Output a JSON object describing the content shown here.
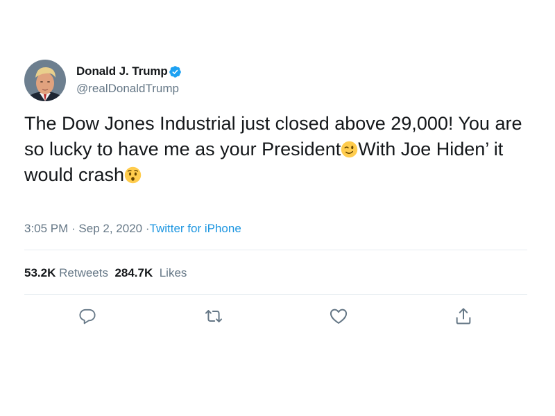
{
  "author": {
    "display_name": "Donald J. Trump",
    "handle": "@realDonaldTrump",
    "verified": true,
    "avatar_icon": "avatar-photo",
    "verified_icon": "verified-badge-icon"
  },
  "tweet": {
    "text_part1": "The Dow Jones Industrial just closed above 29,000! You are so lucky to have me as your President",
    "emoji1": "wink-emoji",
    "text_part2": "With Joe Hiden’ it would crash",
    "emoji2": "hushed-face-emoji"
  },
  "meta": {
    "time": "3:05 PM",
    "separator": " · ",
    "date": "Sep 2, 2020",
    "separator2": " ·",
    "source": "Twitter for iPhone"
  },
  "stats": {
    "retweets_count": "53.2K",
    "retweets_label": "Retweets",
    "likes_count": "284.7K",
    "likes_label": "Likes"
  },
  "actions": {
    "reply_icon": "reply-icon",
    "retweet_icon": "retweet-icon",
    "like_icon": "heart-icon",
    "share_icon": "share-icon"
  },
  "colors": {
    "text_primary": "#14171a",
    "text_secondary": "#657786",
    "link": "#1b95e0",
    "verified": "#1da1f2",
    "divider": "#e6ecf0"
  }
}
